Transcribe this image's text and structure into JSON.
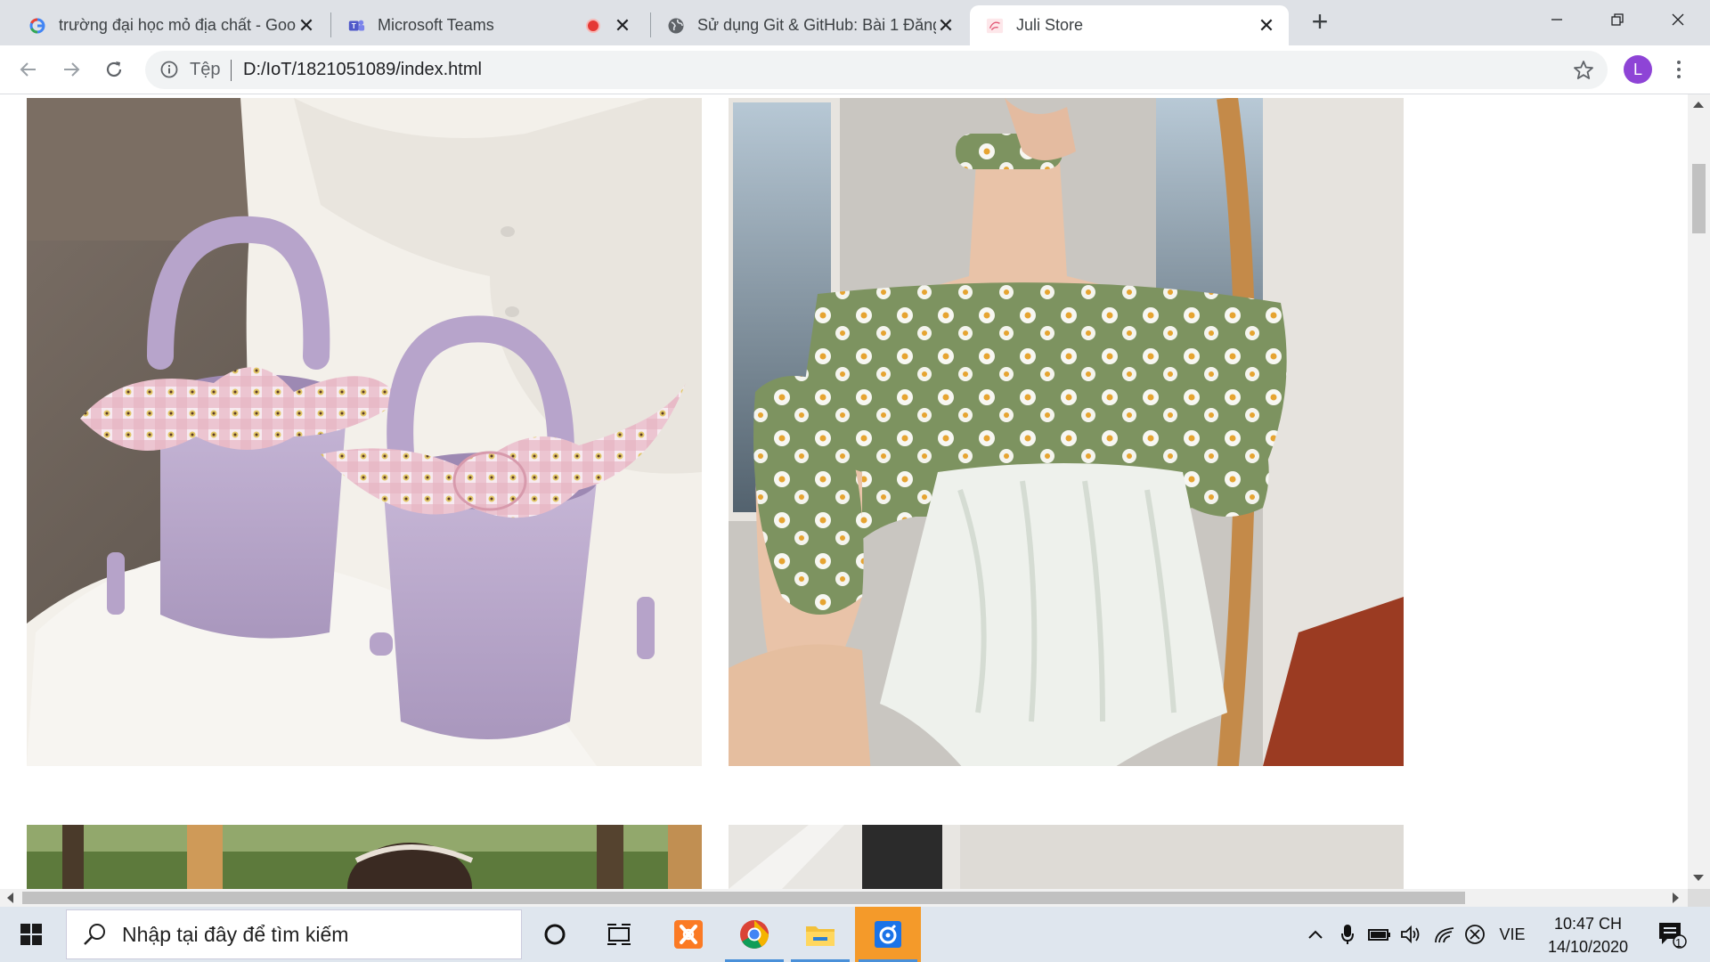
{
  "browser": {
    "tabs": [
      {
        "title": "trường đại học mỏ địa chất - Goo",
        "icon": "google-icon"
      },
      {
        "title": "Microsoft Teams",
        "icon": "teams-icon",
        "recording": true
      },
      {
        "title": "Sử dụng Git & GitHub: Bài 1 Đăng",
        "icon": "globe-icon"
      },
      {
        "title": "Juli Store",
        "icon": "store-icon",
        "active": true
      }
    ],
    "new_tab_label": "+",
    "close_glyph": "✕",
    "address_bar": {
      "scheme_label": "Tệp",
      "url": "D:/IoT/1821051089/index.html"
    },
    "profile_initial": "L"
  },
  "page": {
    "products": [
      {
        "name": "lavender-bucket-bags-photo"
      },
      {
        "name": "daisy-offshoulder-outfit-photo"
      },
      {
        "name": "garden-portrait-photo"
      },
      {
        "name": "white-interior-photo"
      }
    ]
  },
  "taskbar": {
    "search_placeholder": "Nhập tại đây để tìm kiếm",
    "language": "VIE",
    "time": "10:47 CH",
    "date": "14/10/2020",
    "notification_count": "1"
  },
  "colors": {
    "accent": "#1a73e8",
    "avatar": "#8e44d6",
    "tab_bar": "#dee1e6",
    "taskbar": "#dfe6ee"
  }
}
